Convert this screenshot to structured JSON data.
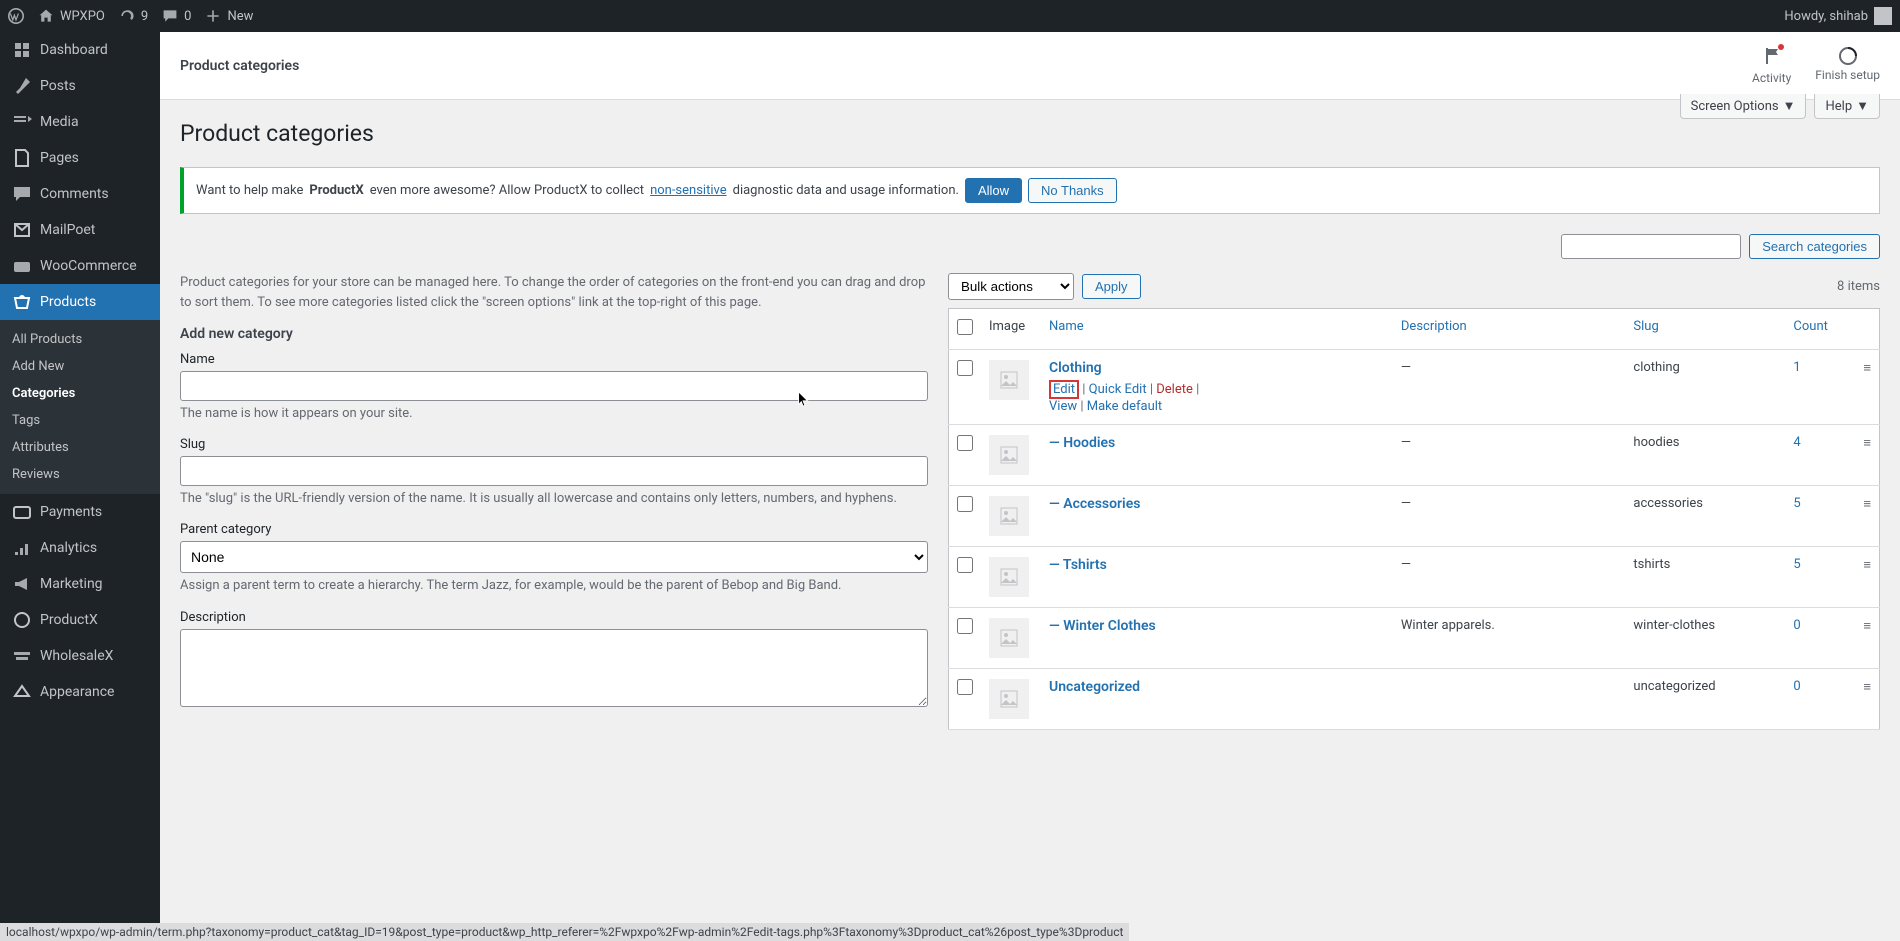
{
  "adminbar": {
    "site": "WPXPO",
    "updates": "9",
    "comments": "0",
    "new": "New",
    "howdy": "Howdy, shihab"
  },
  "sidebar": [
    {
      "label": "Dashboard",
      "icon": "dash"
    },
    {
      "label": "Posts",
      "icon": "pin"
    },
    {
      "label": "Media",
      "icon": "media"
    },
    {
      "label": "Pages",
      "icon": "page"
    },
    {
      "label": "Comments",
      "icon": "comment"
    },
    {
      "label": "MailPoet",
      "icon": "mailpoet"
    },
    {
      "label": "WooCommerce",
      "icon": "woo"
    },
    {
      "label": "Products",
      "icon": "products",
      "current": true,
      "sub": [
        {
          "label": "All Products"
        },
        {
          "label": "Add New"
        },
        {
          "label": "Categories",
          "current": true
        },
        {
          "label": "Tags"
        },
        {
          "label": "Attributes"
        },
        {
          "label": "Reviews"
        }
      ]
    },
    {
      "label": "Payments",
      "icon": "pay"
    },
    {
      "label": "Analytics",
      "icon": "analytics"
    },
    {
      "label": "Marketing",
      "icon": "marketing"
    },
    {
      "label": "ProductX",
      "icon": "px"
    },
    {
      "label": "WholesaleX",
      "icon": "whx"
    },
    {
      "label": "Appearance",
      "icon": "app"
    }
  ],
  "topbar": {
    "title": "Product categories",
    "activity": "Activity",
    "finish": "Finish setup"
  },
  "tabs": {
    "screen": "Screen Options",
    "help": "Help"
  },
  "page_heading": "Product categories",
  "notice": {
    "pre": "Want to help make ",
    "strong": "ProductX",
    "post": " even more awesome? Allow ProductX to collect ",
    "link": "non-sensitive",
    "post2": " diagnostic data and usage information.",
    "allow": "Allow",
    "nothanks": "No Thanks"
  },
  "search_btn": "Search categories",
  "left": {
    "help": "Product categories for your store can be managed here. To change the order of categories on the front-end you can drag and drop to sort them. To see more categories listed click the \"screen options\" link at the top-right of this page.",
    "h2": "Add new category",
    "name": {
      "label": "Name",
      "desc": "The name is how it appears on your site."
    },
    "slug": {
      "label": "Slug",
      "desc": "The \"slug\" is the URL-friendly version of the name. It is usually all lowercase and contains only letters, numbers, and hyphens."
    },
    "parent": {
      "label": "Parent category",
      "option": "None",
      "desc": "Assign a parent term to create a hierarchy. The term Jazz, for example, would be the parent of Bebop and Big Band."
    },
    "desc": {
      "label": "Description"
    }
  },
  "table": {
    "bulk": "Bulk actions",
    "apply": "Apply",
    "items": "8 items",
    "cols": {
      "image": "Image",
      "name": "Name",
      "desc": "Description",
      "slug": "Slug",
      "count": "Count"
    },
    "rows": [
      {
        "name": "Clothing",
        "desc": "—",
        "slug": "clothing",
        "count": "1",
        "actions": true
      },
      {
        "name": "Hoodies",
        "prefix": "— ",
        "desc": "—",
        "slug": "hoodies",
        "count": "4"
      },
      {
        "name": "Accessories",
        "prefix": "— ",
        "desc": "—",
        "slug": "accessories",
        "count": "5"
      },
      {
        "name": "Tshirts",
        "prefix": "— ",
        "desc": "—",
        "slug": "tshirts",
        "count": "5"
      },
      {
        "name": "Winter Clothes",
        "prefix": "— ",
        "desc": "Winter apparels.",
        "slug": "winter-clothes",
        "count": "0"
      },
      {
        "name": "Uncategorized",
        "hidden": true,
        "desc": "",
        "slug": "uncategorized",
        "count": "0"
      }
    ],
    "actions": {
      "edit": "Edit",
      "quick": "Quick Edit",
      "del": "Delete",
      "view": "View",
      "make": "Make default"
    }
  },
  "statusbar": "localhost/wpxpo/wp-admin/term.php?taxonomy=product_cat&tag_ID=19&post_type=product&wp_http_referer=%2Fwpxpo%2Fwp-admin%2Fedit-tags.php%3Ftaxonomy%3Dproduct_cat%26post_type%3Dproduct"
}
